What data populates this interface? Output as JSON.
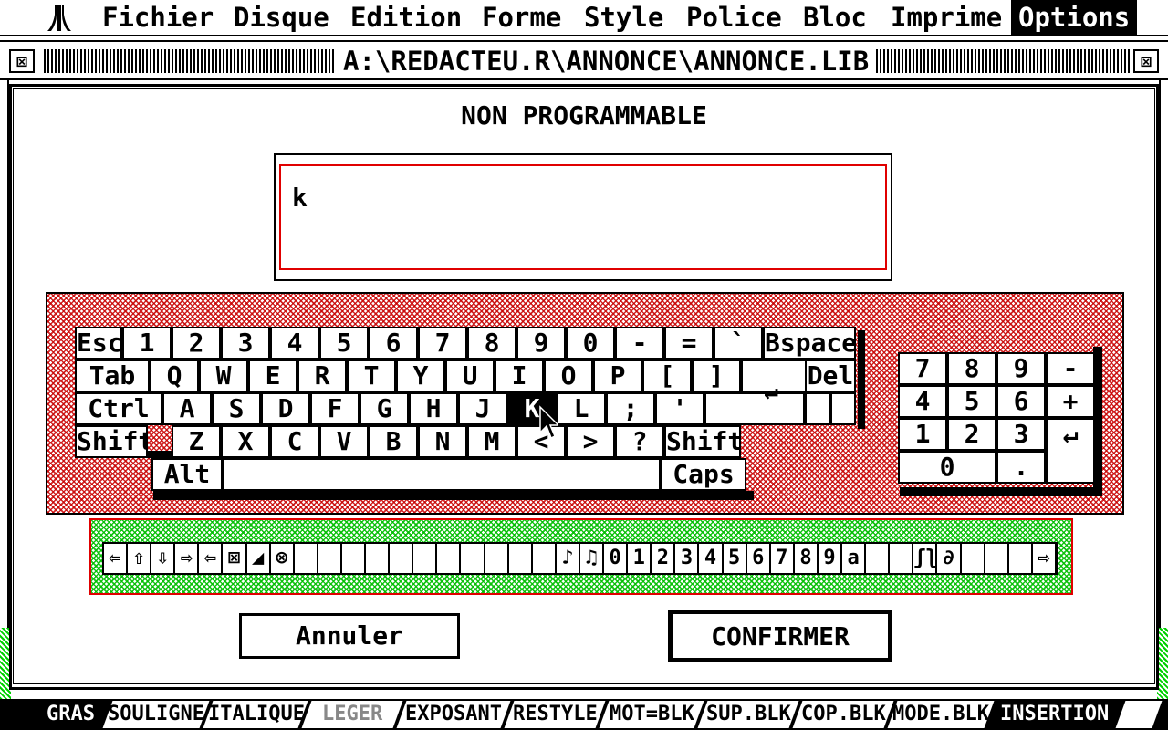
{
  "menu": {
    "items": [
      "Fichier",
      "Disque",
      "Edition",
      "Forme",
      "Style",
      "Police",
      "Bloc",
      "Imprime",
      "Options"
    ],
    "active": "Options"
  },
  "window": {
    "title": "A:\\REDACTEU.R\\ANNONCE\\ANNONCE.LIB",
    "close_glyph": "⊠"
  },
  "dialog": {
    "title": "NON PROGRAMMABLE",
    "input_value": "k"
  },
  "keyboard": {
    "row1": [
      "Esc",
      "1",
      "2",
      "3",
      "4",
      "5",
      "6",
      "7",
      "8",
      "9",
      "0",
      "-",
      "=",
      "`",
      "Bspace"
    ],
    "row2": [
      "Tab",
      "Q",
      "W",
      "E",
      "R",
      "T",
      "Y",
      "U",
      "I",
      "O",
      "P",
      "[",
      "]"
    ],
    "del": "Del",
    "row3": [
      "Ctrl",
      "A",
      "S",
      "D",
      "F",
      "G",
      "H",
      "J",
      "K",
      "L",
      ";",
      "'"
    ],
    "return_glyph": "↵",
    "row4": [
      "Shift",
      "Z",
      "X",
      "C",
      "V",
      "B",
      "N",
      "M",
      "<",
      ">",
      "?",
      "Shift"
    ],
    "alt": "Alt",
    "caps": "Caps",
    "selected_key": "K",
    "numpad": [
      "7",
      "8",
      "9",
      "-",
      "4",
      "5",
      "6",
      "+",
      "1",
      "2",
      "3",
      "0",
      "."
    ],
    "numpad_enter": "↵"
  },
  "symbols": [
    "⇦",
    "⇧",
    "⇩",
    "⇨",
    "⇦",
    "⊠",
    "◢",
    "⊗",
    "",
    "",
    "",
    "",
    "",
    "",
    "",
    "",
    "",
    "",
    " ",
    "♪",
    "♫",
    "0",
    "1",
    "2",
    "3",
    "4",
    "5",
    "6",
    "7",
    "8",
    "9",
    "a",
    "",
    "",
    "ʃʅ",
    "∂",
    "",
    "",
    "",
    "⇨"
  ],
  "buttons": {
    "cancel": "Annuler",
    "confirm": "CONFIRMER"
  },
  "status": {
    "segments": [
      "GRAS",
      "SOULIGNE",
      "ITALIQUE",
      "LEGER",
      "EXPOSANT",
      "RESTYLE",
      "MOT=BLK",
      "SUP.BLK",
      "COP.BLK",
      "MODE.BLK",
      "INSERTION"
    ]
  },
  "colors": {
    "accent_red": "#e00000",
    "accent_green": "#00c000"
  }
}
